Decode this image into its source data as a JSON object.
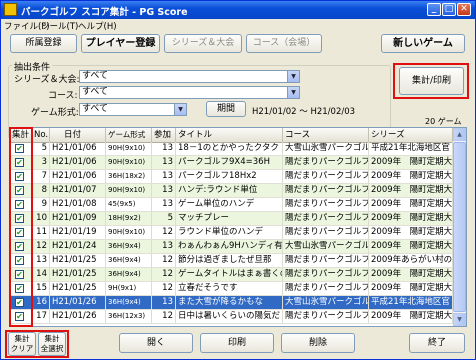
{
  "window": {
    "title": "パークゴルフ スコア集計 - PG Score",
    "min": "_",
    "max": "□",
    "close": "✕"
  },
  "menu": [
    "ファイル(F)",
    "ツール(T)",
    "ヘルプ(H)"
  ],
  "toolbar": {
    "venue_reg": "所属登録",
    "player_reg": "プレイヤー登録",
    "series_tournament": "シリーズ＆大会",
    "course_venue": "コース（会場）",
    "new_game": "新しいゲーム"
  },
  "filter": {
    "group_title": "抽出条件",
    "series_label": "シリーズ＆大会:",
    "series_value": "すべて",
    "course_label": "コース:",
    "course_value": "すべて",
    "format_label": "ゲーム形式:",
    "format_value": "すべて",
    "period_button": "期間",
    "period_range": "H21/01/02 ～ H21/02/03",
    "aggregate_print": "集計/印刷",
    "game_count": "20 ゲーム"
  },
  "table": {
    "columns": [
      "集計",
      "No.",
      "日付",
      "ゲーム形式",
      "参加",
      "タイトル",
      "コース",
      "シリーズ"
    ],
    "rows": [
      {
        "checked": true,
        "no": "5",
        "date": "H21/01/06",
        "format": "90H(9x10)",
        "count": "13",
        "title": "18－1のとかやったクタク",
        "course": "大雪山氷雪パークゴル",
        "series": "平成21年北海地区官"
      },
      {
        "checked": true,
        "no": "3",
        "date": "H21/01/06",
        "format": "90H(9x10)",
        "count": "13",
        "title": "パークゴルフ9X4=36H",
        "course": "陽だまりパークゴルフ",
        "series": "2009年　陽町定期大"
      },
      {
        "checked": true,
        "no": "7",
        "date": "H21/01/06",
        "format": "36H(18x2)",
        "count": "13",
        "title": "パークゴルフ18Hx2",
        "course": "陽だまりパークゴルフ",
        "series": "2009年　陽町定期大"
      },
      {
        "checked": true,
        "no": "8",
        "date": "H21/01/07",
        "format": "90H(9x10)",
        "count": "13",
        "title": "ハンデ:ラウンド単位",
        "course": "陽だまりパークゴルフ",
        "series": "2009年　陽町定期大"
      },
      {
        "checked": true,
        "no": "9",
        "date": "H21/01/08",
        "format": "45(9x5)",
        "count": "13",
        "title": "ゲーム単位のハンデ",
        "course": "陽だまりパークゴルフ",
        "series": "2009年　陽町定期大"
      },
      {
        "checked": true,
        "no": "10",
        "date": "H21/01/09",
        "format": "18H(9x2)",
        "count": "5",
        "title": "マッチプレー",
        "course": "陽だまりパークゴルフ",
        "series": "2009年　陽町定期大"
      },
      {
        "checked": true,
        "no": "11",
        "date": "H21/01/19",
        "format": "90H(9x10)",
        "count": "12",
        "title": "ラウンド単位のハンデ",
        "course": "陽だまりパークゴルフ",
        "series": "2009年　陽町定期大"
      },
      {
        "checked": true,
        "no": "12",
        "date": "H21/01/24",
        "format": "36H(9x4)",
        "count": "13",
        "title": "わぁんわぁん9Hハンディ有",
        "course": "大雪山氷雪パークゴル",
        "series": "2009年　陽町定期大"
      },
      {
        "checked": true,
        "no": "13",
        "date": "H21/01/25",
        "format": "36H(9x4)",
        "count": "12",
        "title": "節分は過ぎましたぜ旦那",
        "course": "陽だまりパークゴルフ",
        "series": "2009年あらがい村のPG"
      },
      {
        "checked": true,
        "no": "14",
        "date": "H21/01/25",
        "format": "36H(9x4)",
        "count": "12",
        "title": "ゲームタイトルはまぁ書くの",
        "course": "陽だまりパークゴルフ",
        "series": "2009年　陽町定期大"
      },
      {
        "checked": true,
        "no": "15",
        "date": "H21/01/25",
        "format": "9H(9x1)",
        "count": "12",
        "title": "立春だそうです",
        "course": "陽だまりパークゴルフ",
        "series": "2009年　陽町定期大"
      },
      {
        "checked": true,
        "no": "16",
        "date": "H21/01/26",
        "format": "36H(9x4)",
        "count": "13",
        "title": "また大雪が降るかもな",
        "course": "大雪山氷雪パークゴル",
        "series": "平成21年北海地区官"
      },
      {
        "checked": true,
        "no": "17",
        "date": "H21/01/26",
        "format": "36H(12x3)",
        "count": "12",
        "title": "日中は暑いくらいの陽気だ",
        "course": "陽だまりパークゴルフ",
        "series": "2009年　陽町定期大"
      }
    ]
  },
  "bottom": {
    "clear": "集計\nクリア",
    "select_all": "集計\n全選択",
    "open": "開く",
    "print": "印刷",
    "delete": "削除",
    "exit": "終了"
  }
}
